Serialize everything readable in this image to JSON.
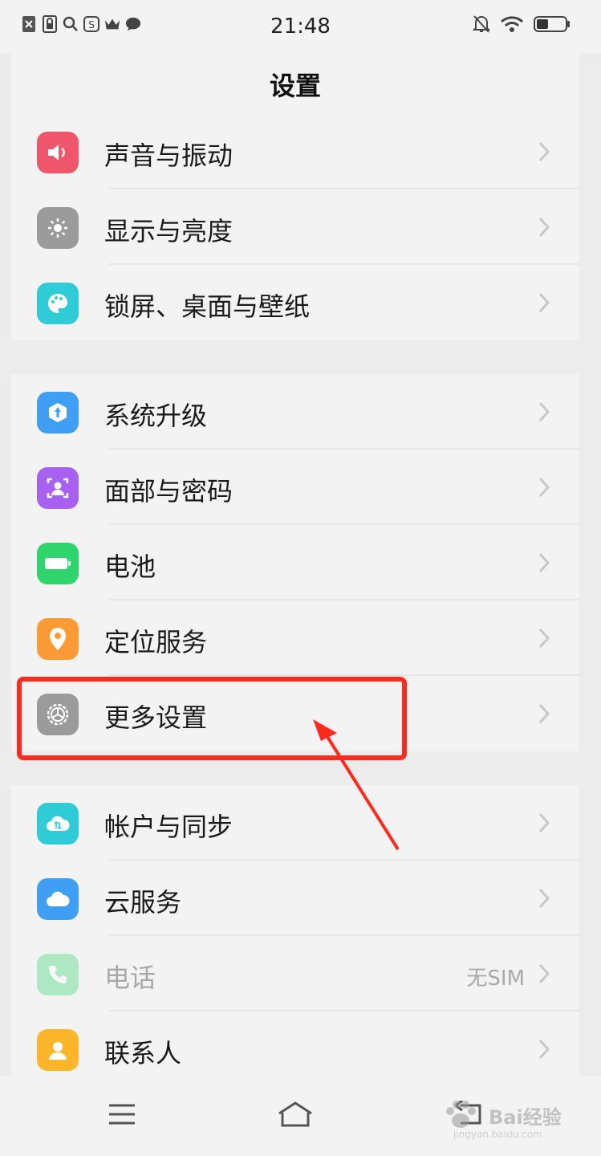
{
  "status_bar": {
    "time": "21:48",
    "left_icons": [
      "sim-off-icon",
      "lock-icon",
      "search-icon",
      "app-icon",
      "crown-icon",
      "chat-bubble-icon"
    ],
    "right_icons": [
      "bell-off-icon",
      "wifi-icon",
      "battery-icon"
    ]
  },
  "header": {
    "title": "设置"
  },
  "groups": [
    [
      {
        "label": "声音与振动",
        "icon": "speaker-icon",
        "color": "#f0566b"
      },
      {
        "label": "显示与亮度",
        "icon": "sun-icon",
        "color": "#9b9b9b"
      },
      {
        "label": "锁屏、桌面与壁纸",
        "icon": "palette-icon",
        "color": "#2fcbd6"
      }
    ],
    [
      {
        "label": "系统升级",
        "icon": "upgrade-icon",
        "color": "#3f9ff5"
      },
      {
        "label": "面部与密码",
        "icon": "face-id-icon",
        "color": "#a860f0"
      },
      {
        "label": "电池",
        "icon": "battery-app-icon",
        "color": "#2fd56c"
      },
      {
        "label": "定位服务",
        "icon": "location-pin-icon",
        "color": "#fc9a36"
      },
      {
        "label": "更多设置",
        "icon": "gear-icon",
        "color": "#9b9b9b"
      }
    ],
    [
      {
        "label": "帐户与同步",
        "icon": "cloud-sync-icon",
        "color": "#2fcbd6"
      },
      {
        "label": "云服务",
        "icon": "cloud-icon",
        "color": "#3f9ff5"
      },
      {
        "label": "电话",
        "value": "无SIM",
        "icon": "phone-icon",
        "color": "#2fd56c",
        "disabled": true
      },
      {
        "label": "联系人",
        "icon": "contact-icon",
        "color": "#fdb62a"
      }
    ]
  ],
  "nav_bar": {
    "buttons": [
      "menu-icon",
      "home-icon",
      "back-icon"
    ]
  },
  "watermark": {
    "text": "Bai经验",
    "sub": "jingyan.baidu.com"
  },
  "annotation": {
    "highlight_color": "#ff2a1e"
  }
}
